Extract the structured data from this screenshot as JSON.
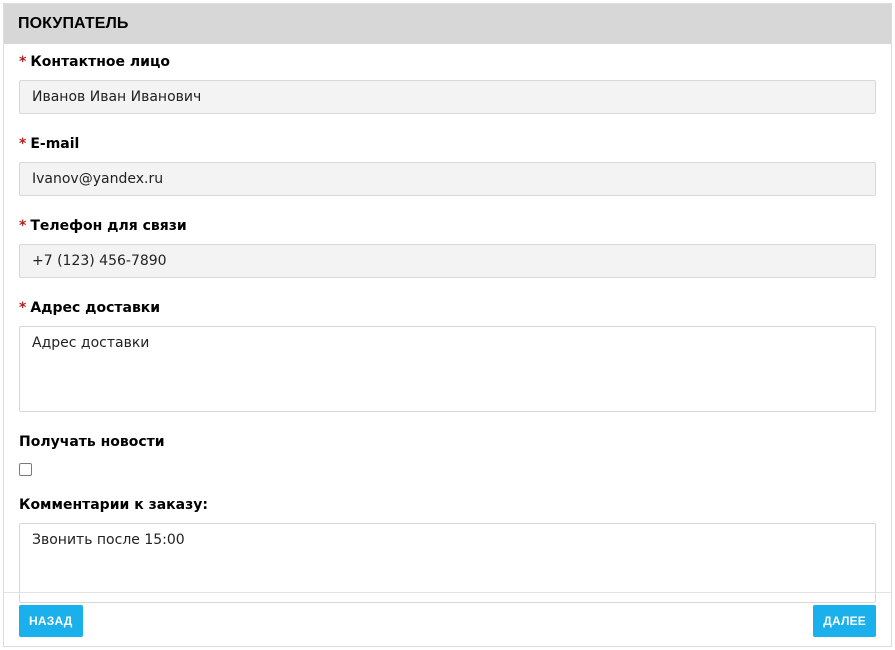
{
  "section": {
    "title": "ПОКУПАТЕЛЬ"
  },
  "fields": {
    "contact": {
      "required_mark": "*",
      "label": "Контактное лицо",
      "value": "Иванов Иван Иванович"
    },
    "email": {
      "required_mark": "*",
      "label": "E-mail",
      "value": "Ivanov@yandex.ru"
    },
    "phone": {
      "required_mark": "*",
      "label": "Телефон для связи",
      "value": "+7 (123) 456-7890"
    },
    "address": {
      "required_mark": "*",
      "label": "Адрес доставки",
      "value": "Адрес доставки"
    },
    "newsletter": {
      "label": "Получать новости",
      "checked": false
    },
    "comment": {
      "label": "Комментарии к заказу:",
      "value": "Звонить после 15:00"
    }
  },
  "footer": {
    "back_label": "НАЗАД",
    "next_label": "ДАЛЕЕ"
  },
  "colors": {
    "header_bg": "#d7d7d7",
    "required": "#b41e1e",
    "button": "#1ab0ec",
    "input_bg": "#f3f3f3"
  }
}
